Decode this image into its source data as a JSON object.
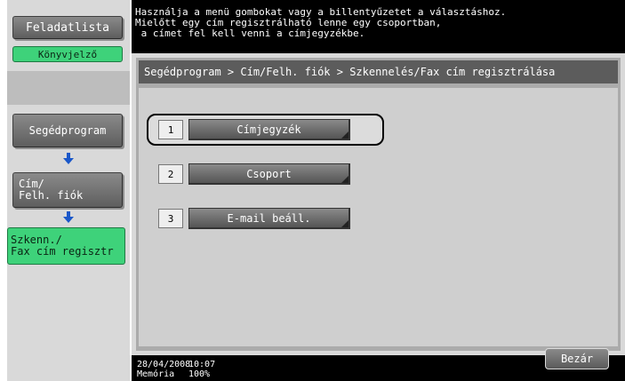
{
  "sidebar": {
    "task_list_label": "Feladatlista",
    "bookmark_label": "Könyvjelző",
    "breadcrumb_utility": "Segédprogram",
    "breadcrumb_address": "Cím/\nFelh. fiók",
    "breadcrumb_register": "Szkenn./\nFax cím regisztr",
    "arrow_icon": "down-arrow-icon"
  },
  "message": {
    "line1": "Használja a menü gombokat vagy a billentyűzetet a választáshoz.",
    "line2": "Mielőtt egy cím regisztrálható lenne egy csoportban,",
    "line3": " a címet fel kell venni a címjegyzékbe."
  },
  "path": "Segédprogram > Cím/Felh. fiók > Szkennelés/Fax cím regisztrálása",
  "menu": {
    "items": [
      {
        "number": "1",
        "label": "Címjegyzék",
        "selected": true
      },
      {
        "number": "2",
        "label": "Csoport",
        "selected": false
      },
      {
        "number": "3",
        "label": "E-mail beáll.",
        "selected": false
      }
    ]
  },
  "footer": {
    "date": "28/04/2008",
    "time": "10:07",
    "memory_label": "Memória",
    "memory_value": "100%",
    "close_label": "Bezár"
  },
  "colors": {
    "accent_green": "#3ed27a",
    "button_gray": "#6f6f6f",
    "bar_black": "#000000"
  }
}
